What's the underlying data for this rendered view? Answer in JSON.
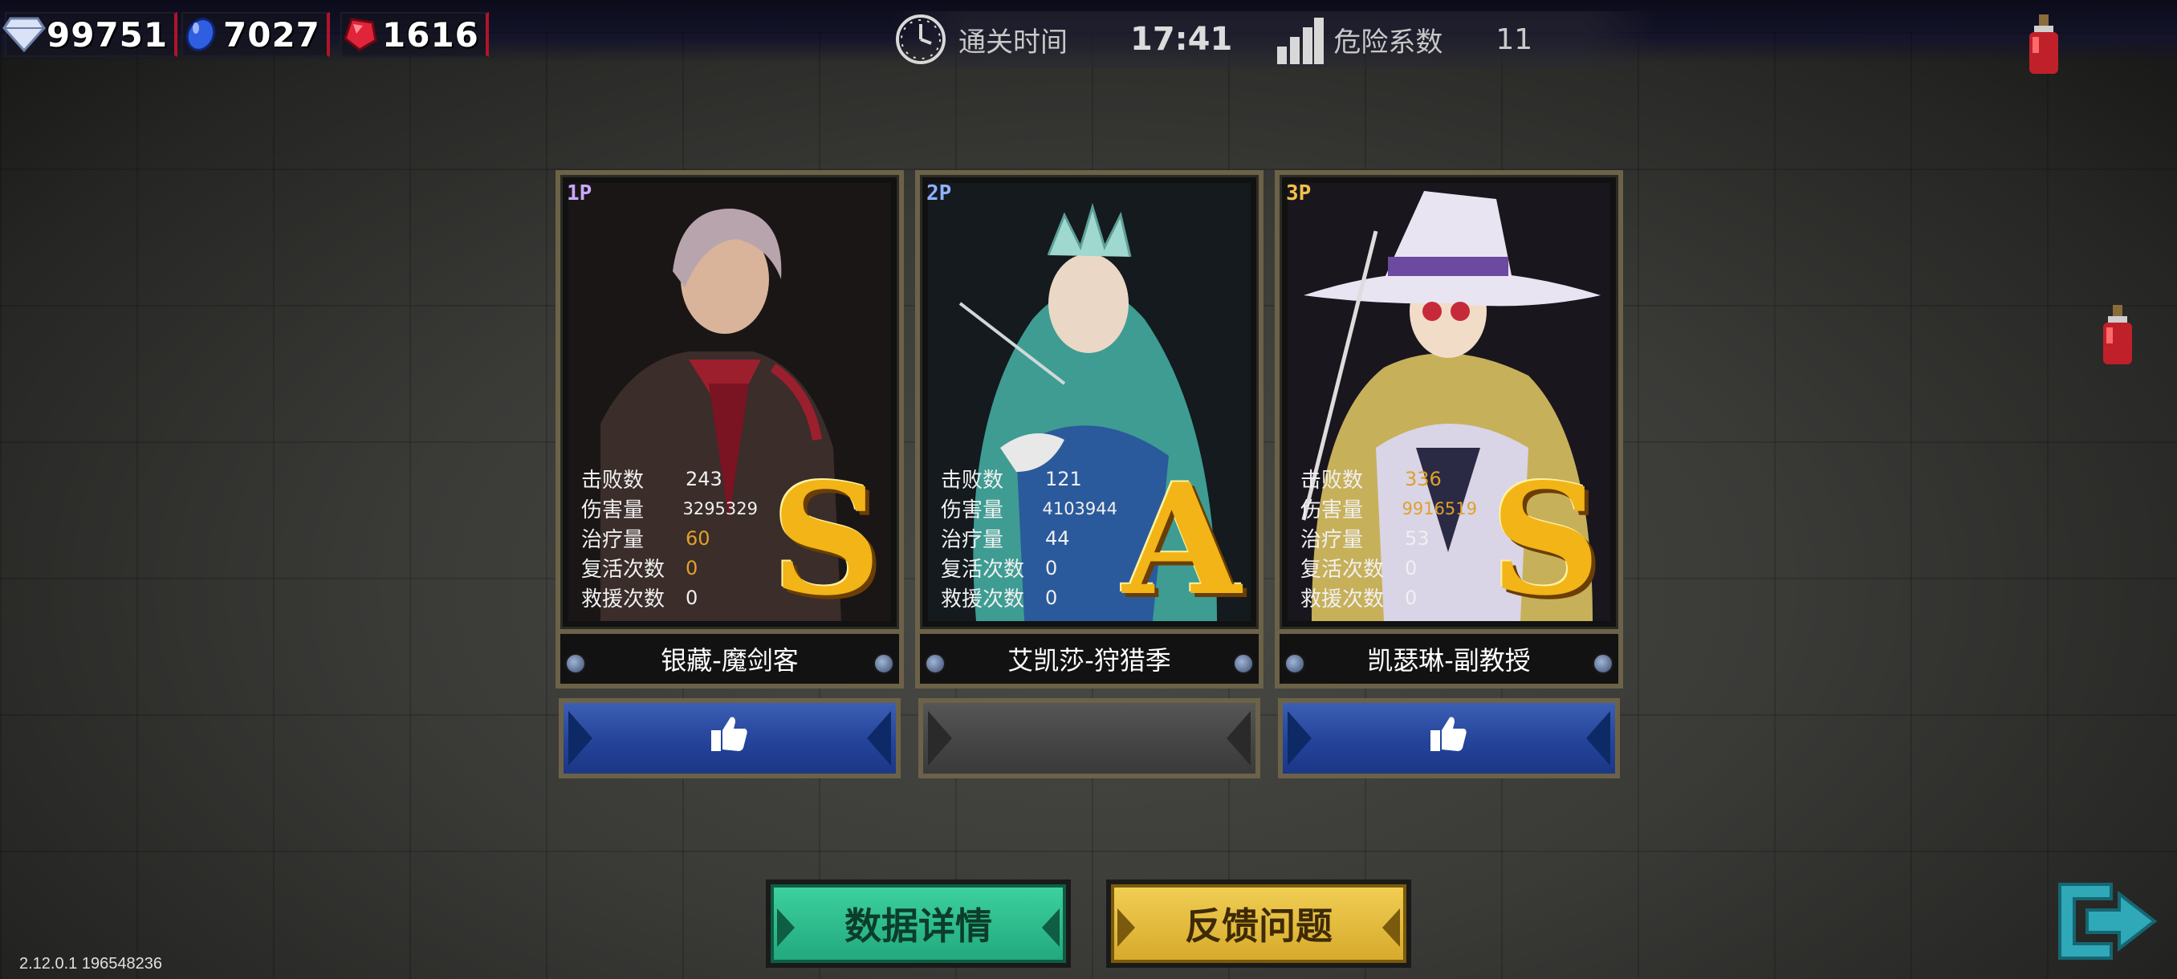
{
  "currencies": [
    {
      "icon": "diamond-icon",
      "value": "99751",
      "color": "#cfd8f0"
    },
    {
      "icon": "blue-gem-icon",
      "value": "7027",
      "color": "#2f5fe0"
    },
    {
      "icon": "red-gem-icon",
      "value": "1616",
      "color": "#e0243a"
    }
  ],
  "top_stats": {
    "clear_time_label": "通关时间",
    "clear_time_value": "17:41",
    "danger_label": "危险系数",
    "danger_value": "11"
  },
  "players": [
    {
      "badge": "1P",
      "badge_color": "#c9a8ff",
      "name": "银藏-魔剑客",
      "grade": "S",
      "stats": [
        {
          "label": "击败数",
          "value": "243",
          "highlight": false
        },
        {
          "label": "伤害量",
          "value": "3295329",
          "highlight": false
        },
        {
          "label": "治疗量",
          "value": "60",
          "highlight": true
        },
        {
          "label": "复活次数",
          "value": "0",
          "highlight": true
        },
        {
          "label": "救援次数",
          "value": "0",
          "highlight": false
        }
      ],
      "like_button": {
        "icon": "thumbs-up-icon",
        "state": "active"
      }
    },
    {
      "badge": "2P",
      "badge_color": "#8fb2ff",
      "name": "艾凯莎-狩猎季",
      "grade": "A",
      "stats": [
        {
          "label": "击败数",
          "value": "121",
          "highlight": false
        },
        {
          "label": "伤害量",
          "value": "4103944",
          "highlight": false
        },
        {
          "label": "治疗量",
          "value": "44",
          "highlight": false
        },
        {
          "label": "复活次数",
          "value": "0",
          "highlight": false
        },
        {
          "label": "救援次数",
          "value": "0",
          "highlight": false
        }
      ],
      "like_button": {
        "icon": "",
        "state": "disabled"
      }
    },
    {
      "badge": "3P",
      "badge_color": "#f2c04a",
      "name": "凯瑟琳-副教授",
      "grade": "S",
      "stats": [
        {
          "label": "击败数",
          "value": "336",
          "highlight": true
        },
        {
          "label": "伤害量",
          "value": "9916519",
          "highlight": true
        },
        {
          "label": "治疗量",
          "value": "53",
          "highlight": false
        },
        {
          "label": "复活次数",
          "value": "0",
          "highlight": false
        },
        {
          "label": "救援次数",
          "value": "0",
          "highlight": false
        }
      ],
      "like_button": {
        "icon": "thumbs-up-icon",
        "state": "active"
      }
    }
  ],
  "buttons": {
    "details": "数据详情",
    "feedback": "反馈问题"
  },
  "exit_icon": "exit-icon",
  "version": "2.12.0.1 196548236",
  "colors": {
    "grade_gold": "#f2b417",
    "like_blue": "#24439a",
    "details_green": "#21a77c",
    "feedback_gold": "#d6a92a"
  }
}
